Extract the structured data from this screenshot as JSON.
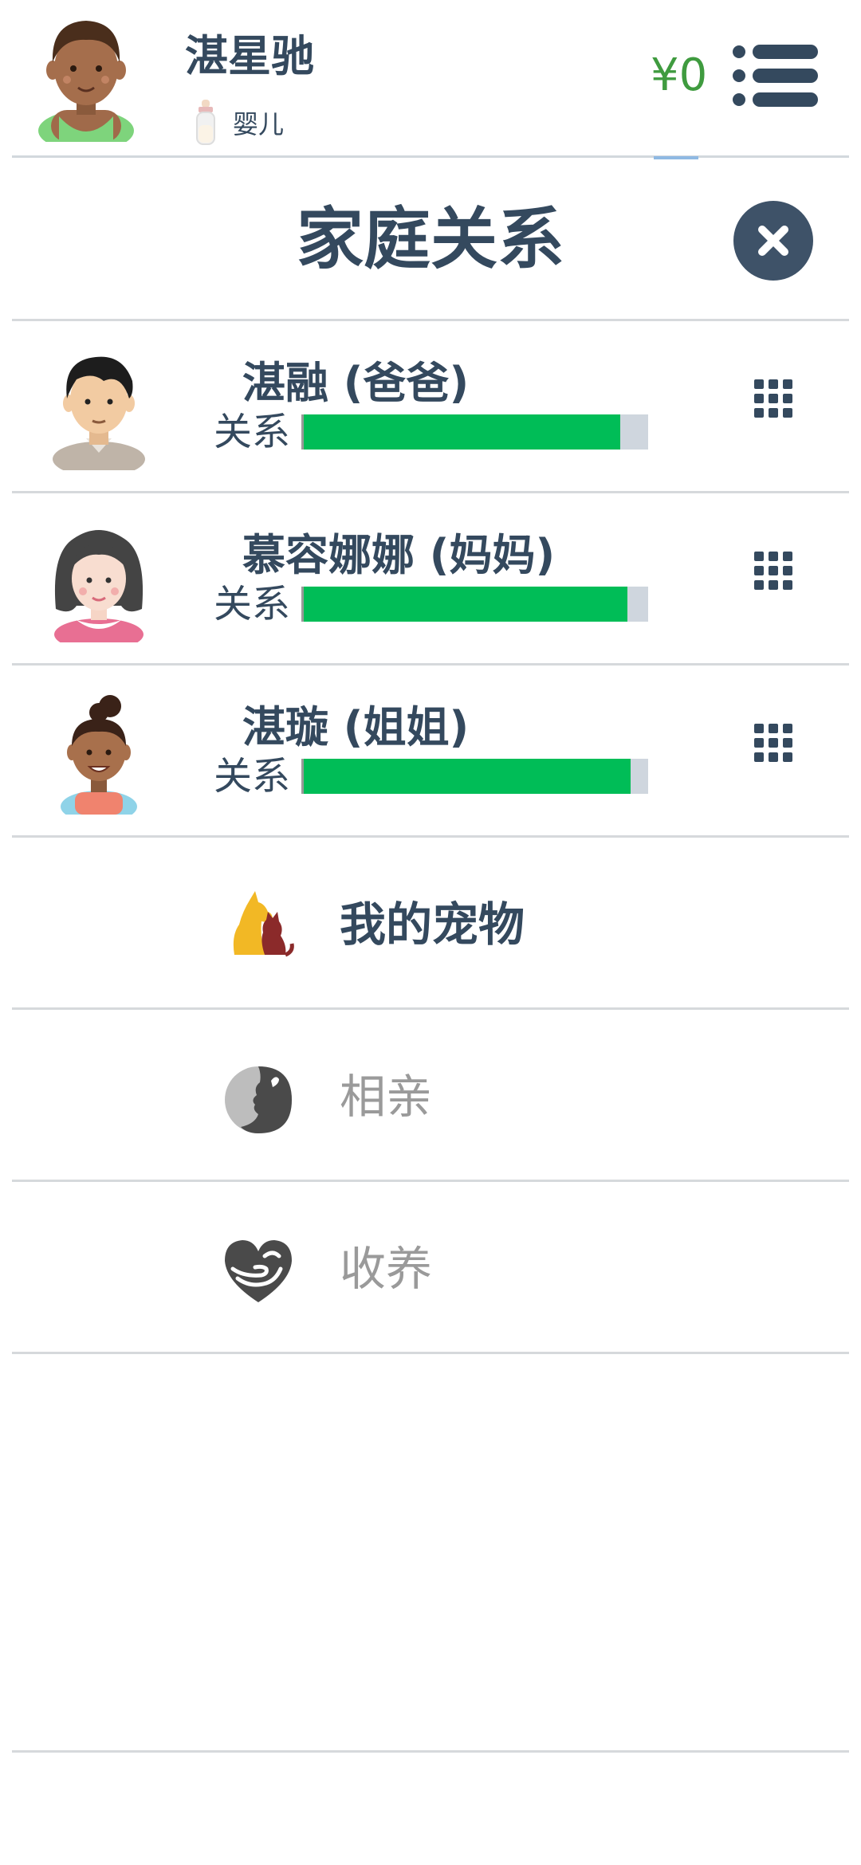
{
  "header": {
    "name": "湛星驰",
    "stage_label": "婴儿",
    "money": "¥0"
  },
  "dialog": {
    "title": "家庭关系"
  },
  "family": [
    {
      "name": "湛融 (爸爸)",
      "relation_label": "关系",
      "relation_level": 0.92
    },
    {
      "name": "慕容娜娜 (妈妈)",
      "relation_label": "关系",
      "relation_level": 0.94
    },
    {
      "name": "湛璇 (姐姐)",
      "relation_label": "关系",
      "relation_level": 0.95
    }
  ],
  "menu": [
    {
      "label": "我的宠物",
      "icon": "pet-icon",
      "style": "active"
    },
    {
      "label": "相亲",
      "icon": "dating-icon",
      "style": "muted"
    },
    {
      "label": "收养",
      "icon": "adoption-heart-icon",
      "style": "muted"
    }
  ],
  "colors": {
    "text": "#34495e",
    "money": "#3f9b3f",
    "relation_bar": "#00bd57",
    "relation_track": "#cfd6de",
    "muted": "#9a9a9a"
  }
}
